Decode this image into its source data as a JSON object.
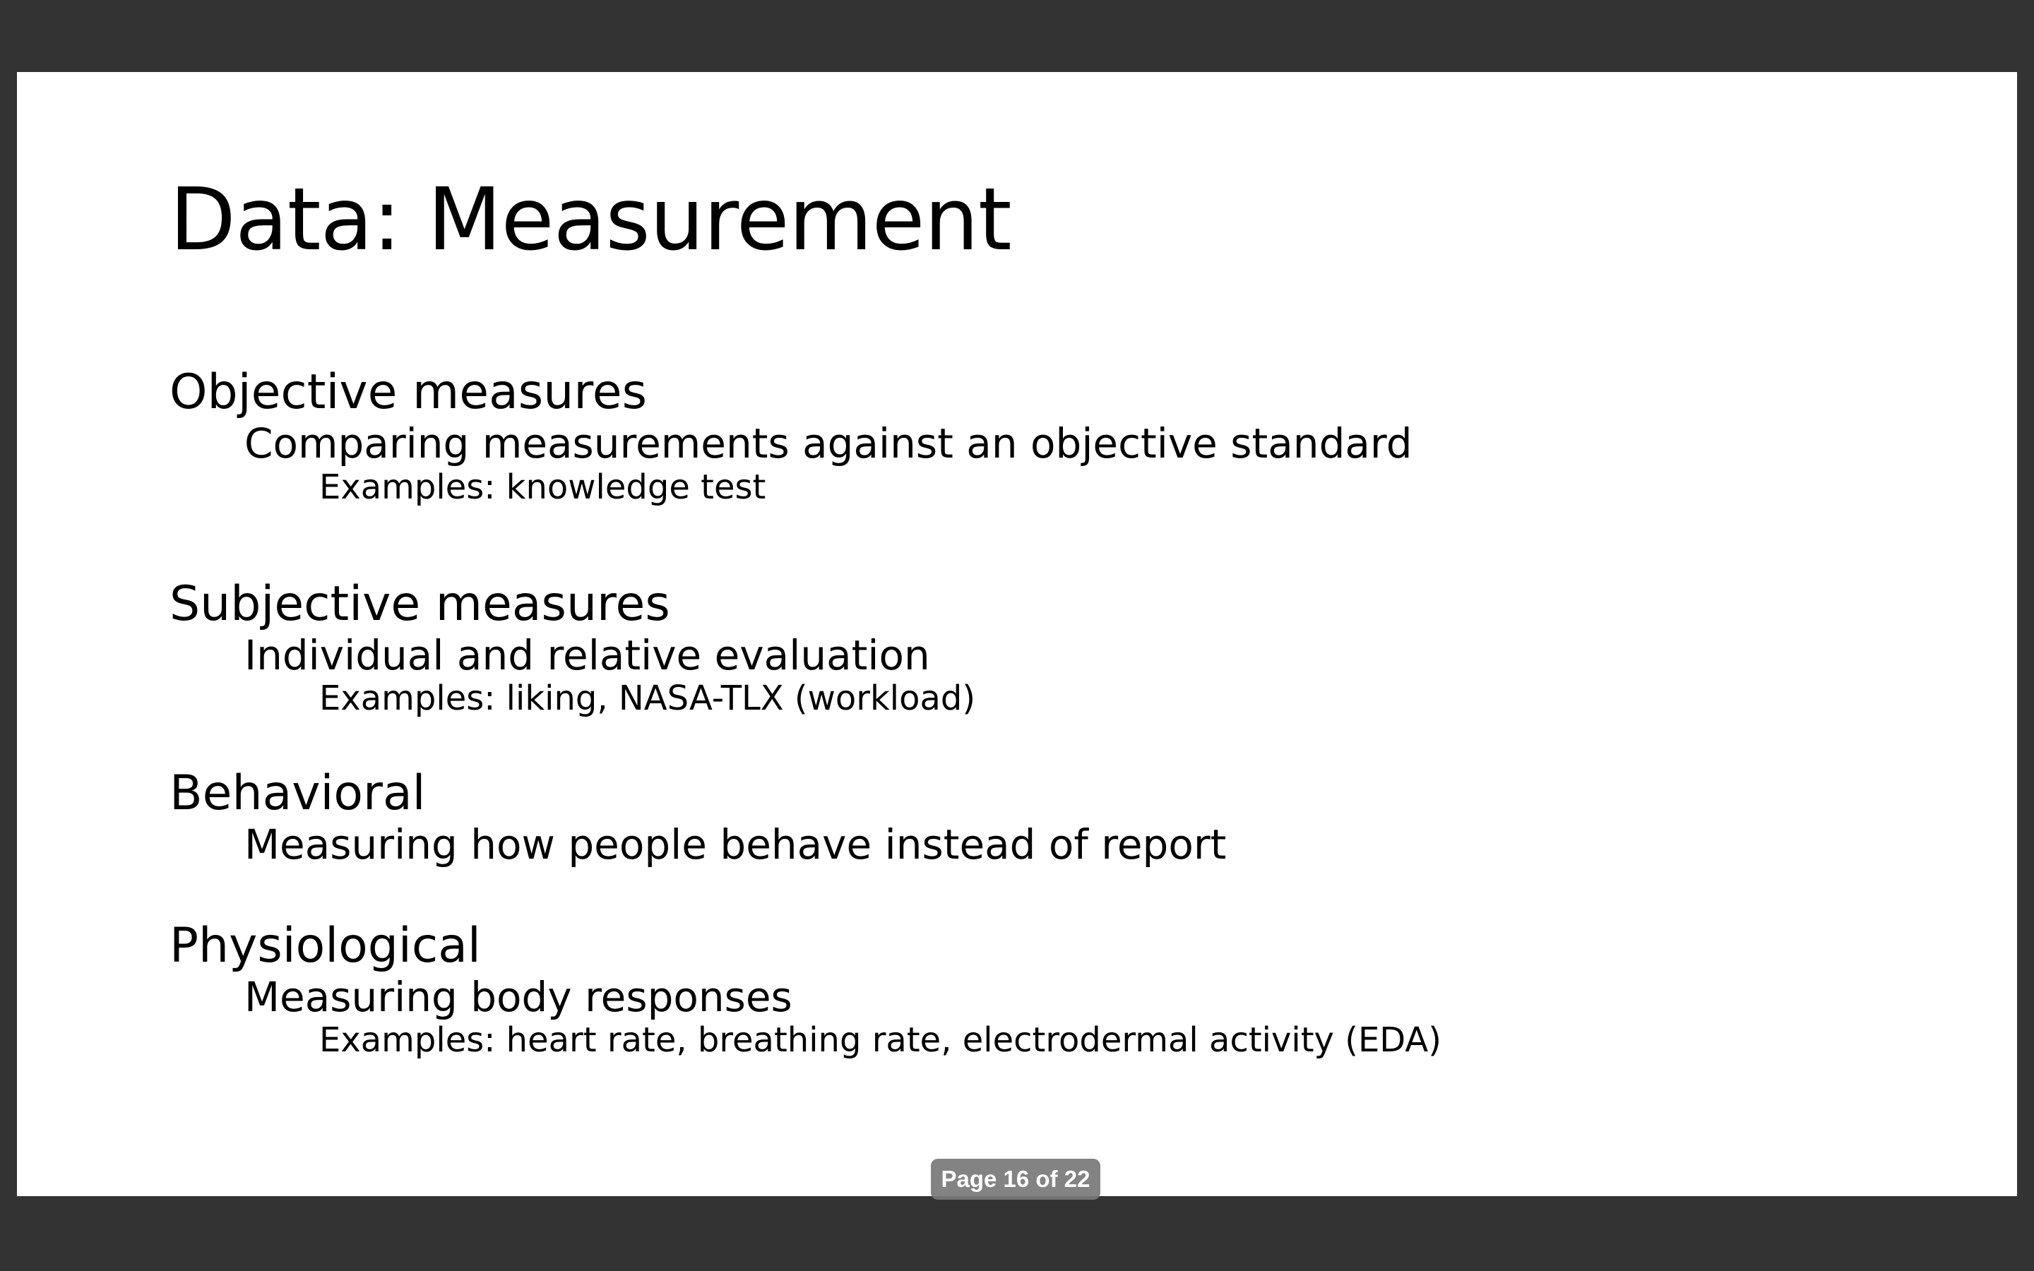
{
  "slide": {
    "title": "Data: Measurement",
    "sections": [
      {
        "heading": "Objective measures",
        "description": "Comparing measurements against an objective standard",
        "examples": "Examples: knowledge test"
      },
      {
        "heading": "Subjective measures",
        "description": "Individual and relative evaluation",
        "examples": "Examples: liking, NASA-TLX (workload)"
      },
      {
        "heading": "Behavioral",
        "description": "Measuring how people behave instead of report"
      },
      {
        "heading": "Physiological",
        "description": "Measuring body responses",
        "examples": "Examples: heart rate, breathing rate, electrodermal activity (EDA)"
      }
    ]
  },
  "viewer": {
    "page_indicator": "Page 16 of 22",
    "background_color": "#333333",
    "page_color": "#ffffff",
    "indicator_color": "#7a7a7a"
  }
}
